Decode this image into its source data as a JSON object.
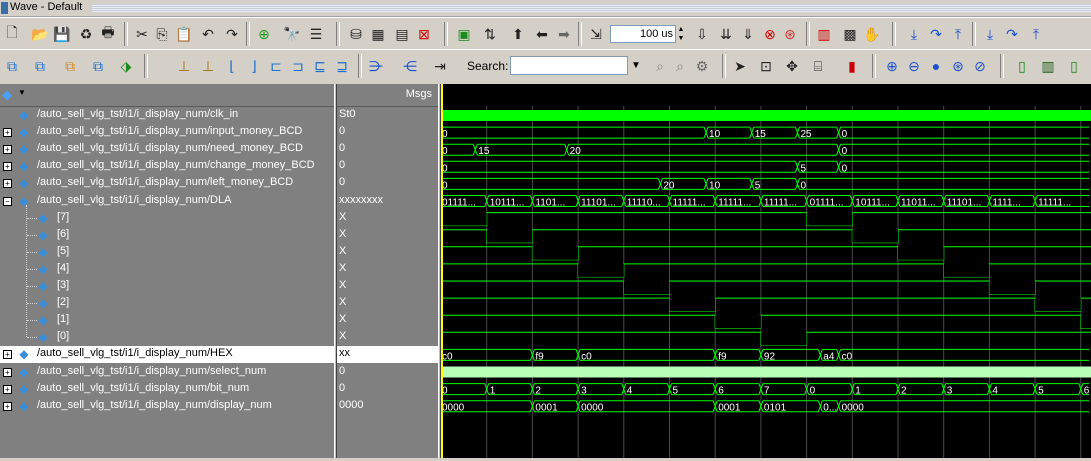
{
  "window": {
    "title": "Wave - Default"
  },
  "toolbar": {
    "zoom_value": "100 us",
    "search_label": "Search:",
    "search_value": ""
  },
  "header": {
    "msgs_label": "Msgs"
  },
  "signals": [
    {
      "name": "/auto_sell_vlg_tst/i1/i_display_num/clk_in",
      "value": "St0",
      "expandable": false
    },
    {
      "name": "/auto_sell_vlg_tst/i1/i_display_num/input_money_BCD",
      "value": "0",
      "expandable": true
    },
    {
      "name": "/auto_sell_vlg_tst/i1/i_display_num/need_money_BCD",
      "value": "0",
      "expandable": true
    },
    {
      "name": "/auto_sell_vlg_tst/i1/i_display_num/change_money_BCD",
      "value": "0",
      "expandable": true
    },
    {
      "name": "/auto_sell_vlg_tst/i1/i_display_num/left_money_BCD",
      "value": "0",
      "expandable": true
    },
    {
      "name": "/auto_sell_vlg_tst/i1/i_display_num/DLA",
      "value": "xxxxxxxx",
      "expandable": true,
      "expanded": true
    },
    {
      "name": "[7]",
      "value": "X",
      "child": true
    },
    {
      "name": "[6]",
      "value": "X",
      "child": true
    },
    {
      "name": "[5]",
      "value": "X",
      "child": true
    },
    {
      "name": "[4]",
      "value": "X",
      "child": true
    },
    {
      "name": "[3]",
      "value": "X",
      "child": true
    },
    {
      "name": "[2]",
      "value": "X",
      "child": true
    },
    {
      "name": "[1]",
      "value": "X",
      "child": true
    },
    {
      "name": "[0]",
      "value": "X",
      "child": true
    },
    {
      "name": "/auto_sell_vlg_tst/i1/i_display_num/HEX",
      "value": "xx",
      "expandable": true,
      "selected": true
    },
    {
      "name": "/auto_sell_vlg_tst/i1/i_display_num/select_num",
      "value": "0",
      "expandable": true
    },
    {
      "name": "/auto_sell_vlg_tst/i1/i_display_num/bit_num",
      "value": "0",
      "expandable": true
    },
    {
      "name": "/auto_sell_vlg_tst/i1/i_display_num/display_num",
      "value": "0000",
      "expandable": true
    }
  ],
  "waves": {
    "input_money_BCD": [
      "0",
      "10",
      "15",
      "25",
      "0"
    ],
    "need_money_BCD": [
      "0",
      "15",
      "20",
      "0"
    ],
    "change_money_BCD": [
      "0",
      "5",
      "0"
    ],
    "left_money_BCD": [
      "0",
      "20",
      "10",
      "5",
      "0"
    ],
    "DLA": [
      "01111...",
      "10111...",
      "1101...",
      "11101...",
      "11110...",
      "11111...",
      "11111...",
      "11111...",
      "01111...",
      "10111...",
      "11011...",
      "11101...",
      "1111...",
      "11111..."
    ],
    "HEX": [
      "c0",
      "f9",
      "c0",
      "f9",
      "92",
      "a4",
      "c0"
    ],
    "bit_num": [
      "0",
      "1",
      "2",
      "3",
      "4",
      "5",
      "6",
      "7",
      "0",
      "1",
      "2",
      "3",
      "4",
      "5",
      "6"
    ],
    "display_num": [
      "0000",
      "0001",
      "0000",
      "0001",
      "0101",
      "0...",
      "0000"
    ]
  },
  "colors": {
    "wave": "#00ff00",
    "select_num_fill": "#b8ffb8",
    "cursor": "#ffff00",
    "background": "#000000"
  },
  "icons": {
    "row1": [
      "new-file-icon",
      "open-folder-icon",
      "save-icon",
      "reload-icon",
      "print-icon",
      "cut-icon",
      "copy-icon",
      "paste-icon",
      "undo-icon",
      "redo-icon",
      "add-wave-icon",
      "find-icon",
      "format-icon"
    ],
    "row2": [
      "insert-icon",
      "group-icon",
      "zoom-full-icon",
      "zoom-in-icon",
      "zoom-out-icon",
      "zoom-cursor-icon",
      "select-mode-icon",
      "wave-compare-icon"
    ]
  }
}
